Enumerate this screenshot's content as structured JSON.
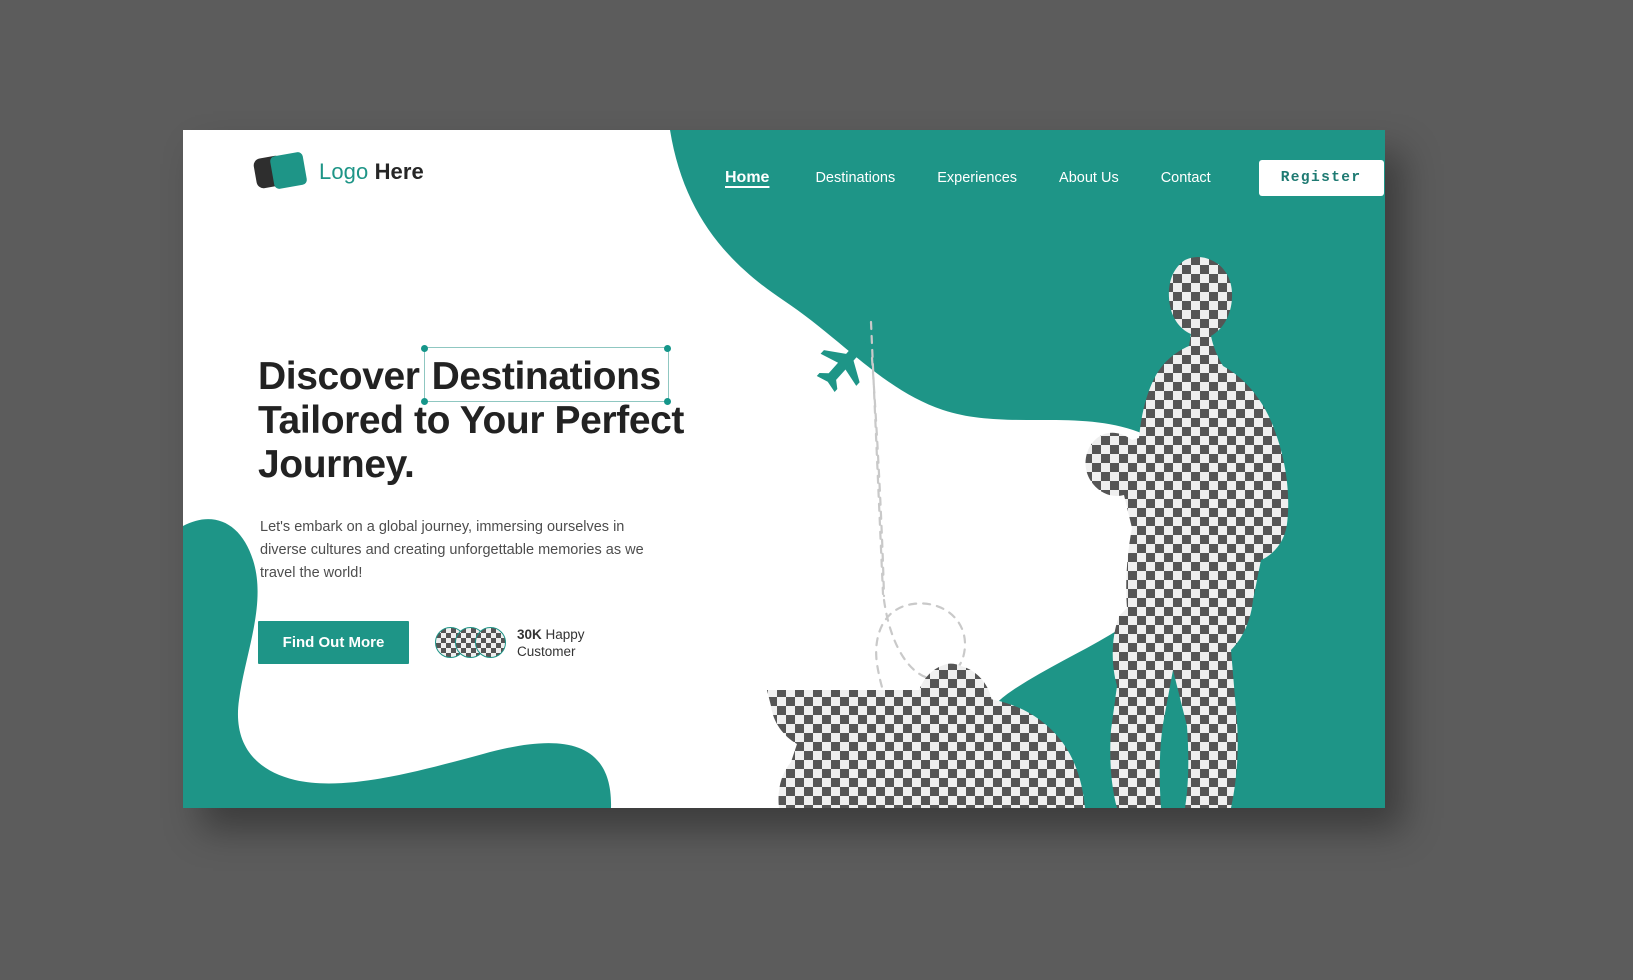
{
  "canvas": {
    "background_color": "#5c5c5c",
    "artboard_background": "#ffffff"
  },
  "theme": {
    "accent": "#1e9587",
    "accent_dark": "#1e7a72",
    "dark": "#2e2e2e",
    "body_text": "#4d4d4d",
    "heading_text": "#222222",
    "selection_border": "#8fc7c1",
    "selection_handle": "#15968a",
    "dot_inactive": "#8a8a8a",
    "checker_dark": "#555555",
    "checker_light": "#efefef"
  },
  "brand": {
    "logo_icon": "overlapping-squares-logo",
    "name_first": "Logo",
    "name_second": "Here"
  },
  "nav": {
    "items": [
      {
        "label": "Home",
        "active": true
      },
      {
        "label": "Destinations",
        "active": false
      },
      {
        "label": "Experiences",
        "active": false
      },
      {
        "label": "About Us",
        "active": false
      },
      {
        "label": "Contact",
        "active": false
      }
    ],
    "register_label": "Register"
  },
  "hero": {
    "headline_part1": "Discover",
    "headline_selected": "Destinations",
    "headline_part2": "Tailored to Your Perfect Journey.",
    "subcopy": "Let's embark on a global journey, immersing ourselves in diverse cultures and creating unforgettable memories as we travel the world!",
    "cta_label": "Find Out More",
    "customer_count": "30K",
    "customer_label_line1": " Happy",
    "customer_label_line2": "Customer",
    "avatar_count": 3,
    "avatar_icon": "checkerboard-avatar"
  },
  "decor": {
    "plane_icon": "airplane-icon",
    "trail_icon": "dashed-flight-path",
    "people_icon": "checkerboard-traveler-silhouettes",
    "blob_right": "teal-organic-blob",
    "blob_bottom_left": "teal-organic-blob"
  },
  "carousel": {
    "dots": [
      {
        "active": false
      },
      {
        "active": true
      },
      {
        "active": false
      }
    ]
  }
}
